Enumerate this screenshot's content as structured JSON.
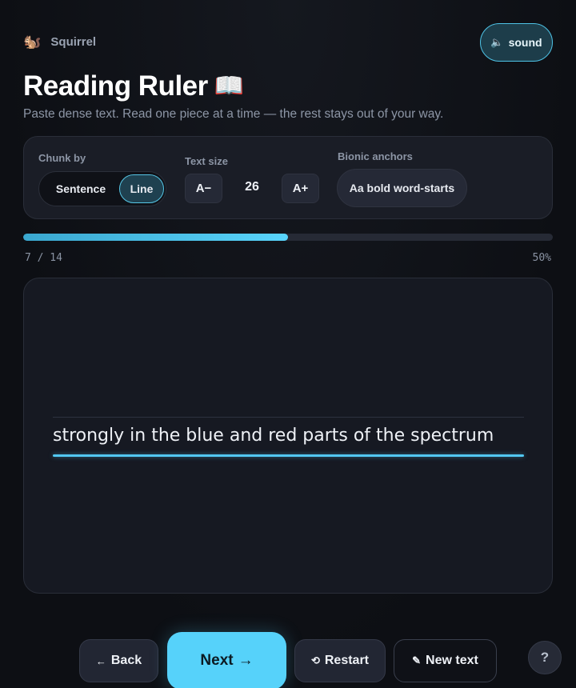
{
  "header": {
    "brand_icon": "🐿️",
    "brand_name": "Squirrel",
    "sound_icon": "🔈",
    "sound_label": "sound",
    "title": "Reading Ruler",
    "title_icon": "📖",
    "subtitle": "Paste dense text. Read one piece at a time — the rest stays out of your way."
  },
  "controls": {
    "chunk_label": "Chunk by",
    "chunk_options": [
      "Sentence",
      "Line"
    ],
    "chunk_selected": "Line",
    "size_label": "Text size",
    "size_decrease": "A−",
    "size_value": "26",
    "size_increase": "A+",
    "bionic_label": "Bionic anchors",
    "bionic_button": "Aa bold word-starts"
  },
  "progress": {
    "current": 7,
    "total": 14,
    "count_text": "7 / 14",
    "percent_text": "50%",
    "fraction": 0.5
  },
  "reader": {
    "chunk": "strongly in the blue and red parts of the spectrum"
  },
  "nav": {
    "back_icon": "←",
    "back_label": "Back",
    "next_label": "Next",
    "next_icon": "→",
    "restart_icon": "⟲",
    "restart_label": "Restart",
    "newtext_icon": "✎",
    "newtext_label": "New text",
    "help_label": "?"
  },
  "colors": {
    "accent": "#56d2fa",
    "background": "#0d0f14",
    "panel": "#1a1d26"
  }
}
